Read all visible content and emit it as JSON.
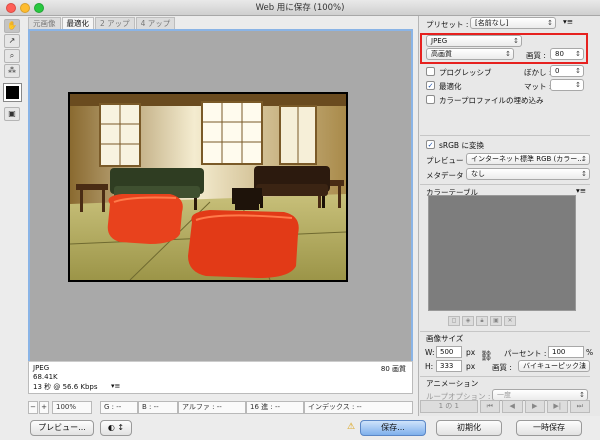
{
  "window": {
    "title": "Web 用に保存 (100%)"
  },
  "tools": [
    {
      "icon": "hand-tool-icon",
      "glyph": "✋"
    },
    {
      "icon": "slice-select-tool-icon",
      "glyph": "↗"
    },
    {
      "icon": "zoom-tool-icon",
      "glyph": "⌕"
    },
    {
      "icon": "eyedropper-tool-icon",
      "glyph": "⁂"
    },
    {
      "icon": "toggle-slices-icon",
      "glyph": "▣"
    }
  ],
  "tabs": [
    "元画像",
    "最適化",
    "2 アップ",
    "4 アップ"
  ],
  "active_tab": 1,
  "image_info": {
    "format": "JPEG",
    "size": "68.41K",
    "time": "13 秒 @ 56.6 Kbps",
    "quality_label": "80 画質"
  },
  "status": {
    "zoom": "100%",
    "g": "G : --",
    "b": "B : --",
    "alpha": "アルファ : --",
    "hex": "16 進 : --",
    "index": "インデックス : --"
  },
  "buttons": {
    "preview": "プレビュー...",
    "save": "保存...",
    "reset": "初期化",
    "remember": "一時保存"
  },
  "settings": {
    "preset_label": "プリセット :",
    "preset_value": "[名前なし]",
    "format": "JPEG",
    "quality_preset": "高画質",
    "quality_label": "画質 :",
    "quality_value": "80",
    "progressive": "プログレッシブ",
    "blur_label": "ぼかし :",
    "blur_value": "0",
    "optimized": "最適化",
    "matte_label": "マット :",
    "icc": "カラープロファイルの埋め込み",
    "srgb": "sRGB に変換",
    "preview_label": "プレビュー :",
    "preview_value": "インターネット標準 RGB (カラー...",
    "metadata_label": "メタデータ :",
    "metadata_value": "なし"
  },
  "color_table": {
    "title": "カラーテーブル"
  },
  "image_size": {
    "title": "画像サイズ",
    "w_label": "W:",
    "w_value": "500",
    "h_label": "H:",
    "h_value": "333",
    "unit": "px",
    "percent_label": "パーセント :",
    "percent_value": "100",
    "percent_unit": "%",
    "quality_label": "画質 :",
    "quality_value": "バイキューピック法"
  },
  "animation": {
    "title": "アニメーション",
    "loop_label": "ループオプション :",
    "loop_value": "一度",
    "frame": "1 の 1"
  },
  "colors": {
    "highlight": "#e6211f",
    "canvas_bg": "#a9a9a9",
    "ottoman": "#e8421d",
    "sofa": "#2f3d22"
  }
}
